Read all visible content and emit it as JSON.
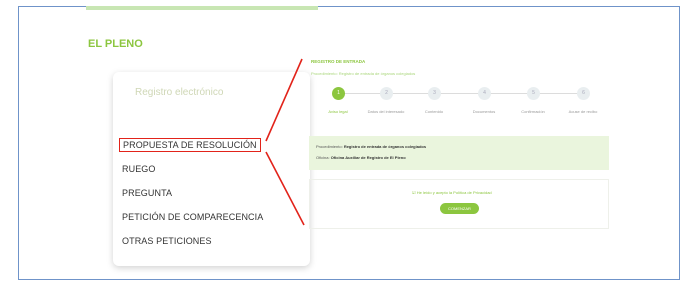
{
  "header": {
    "title": "EL PLENO"
  },
  "left_card": {
    "title": "Registro electrónico",
    "items": [
      {
        "label": "PROPUESTA DE RESOLUCIÓN",
        "selected": true
      },
      {
        "label": "RUEGO"
      },
      {
        "label": "PREGUNTA"
      },
      {
        "label": "PETICIÓN DE COMPARECENCIA"
      },
      {
        "label": "OTRAS PETICIONES"
      }
    ]
  },
  "registro": {
    "title": "REGISTRO DE ENTRADA",
    "procedure_line": "Procedimiento: Registro de entrada de órganos colegiados",
    "steps": [
      {
        "number": "1",
        "label": "Aviso legal",
        "active": true
      },
      {
        "number": "2",
        "label": "Datos del interesado"
      },
      {
        "number": "3",
        "label": "Contenido"
      },
      {
        "number": "4",
        "label": "Documentos"
      },
      {
        "number": "5",
        "label": "Confirmación"
      },
      {
        "number": "6",
        "label": "Acuse de recibo"
      }
    ],
    "info": {
      "procedure_label": "Procedimiento:",
      "procedure_value": "Registro de entrada de órganos colegiados",
      "office_label": "Oficina:",
      "office_value": "Oficina Auxiliar de Registro de El Pleno"
    },
    "privacy_text": "He leído y acepto la Política de Privacidad",
    "start_button": "COMENZAR"
  },
  "colors": {
    "accent": "#8cc63f",
    "highlight": "#e2231a",
    "frame": "#6f93c9"
  }
}
